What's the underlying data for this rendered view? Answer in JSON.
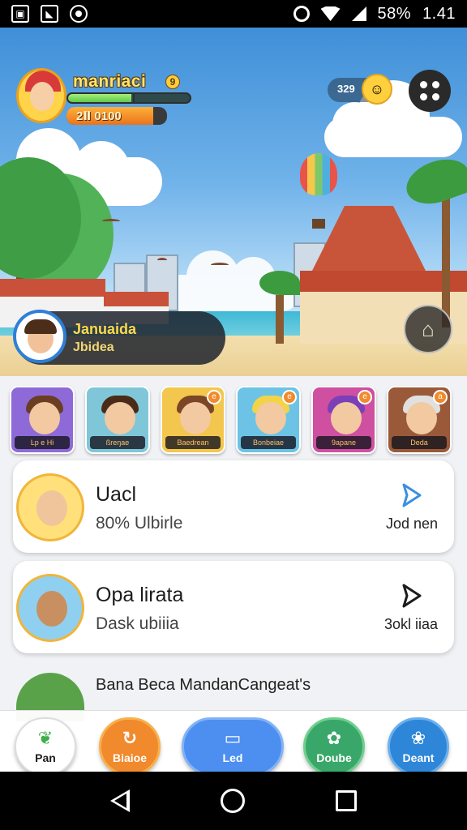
{
  "status_bar": {
    "battery": "58%",
    "time": "1.41"
  },
  "profile": {
    "name": "manriaci",
    "level": "9",
    "coins_label": "2Ⅱ 0100",
    "xp_progress": 0.52,
    "coins_progress": 0.86
  },
  "currency": {
    "gems": "329"
  },
  "neighbor": {
    "name": "Januaida",
    "subtitle": "Jbidea"
  },
  "friends": [
    {
      "label": "Ŀp e Hi",
      "hair": "#6b3e24",
      "bg": "#8e6ad8"
    },
    {
      "label": "ßreŋae",
      "hair": "#4a2b18",
      "bg": "#7fc6d8"
    },
    {
      "label": "Baedrean",
      "hair": "#7a4626",
      "bg": "#f3c64e",
      "badge": "e"
    },
    {
      "label": "Bonbeiae",
      "hair": "#f2d34a",
      "bg": "#6cc3e6",
      "badge": "e"
    },
    {
      "label": "9apane",
      "hair": "#7b3fb8",
      "bg": "#cf4fa0",
      "badge": "e"
    },
    {
      "label": "Deda",
      "hair": "#e0e0e0",
      "bg": "#9a5a3a",
      "badge": "a"
    }
  ],
  "cards": [
    {
      "title": "Uacl",
      "subtitle": "80% Ulbirle",
      "action": "Jod nen",
      "icon_bg": "#ffe07a"
    },
    {
      "title": "Opa lirata",
      "subtitle": "Dask ubiiia",
      "action": "3okl iiaa",
      "icon_bg": "#8fd0f0"
    }
  ],
  "partial_card": {
    "title": "Bana Beca  MandanCangeat's"
  },
  "bottom_nav": [
    {
      "label": "Pan",
      "icon": "leaf-icon"
    },
    {
      "label": "Biaioe",
      "icon": "refresh-icon"
    },
    {
      "label": "Led",
      "icon": "card-icon"
    },
    {
      "label": "Doube",
      "icon": "frog-icon"
    },
    {
      "label": "Deant",
      "icon": "flower-icon"
    }
  ]
}
